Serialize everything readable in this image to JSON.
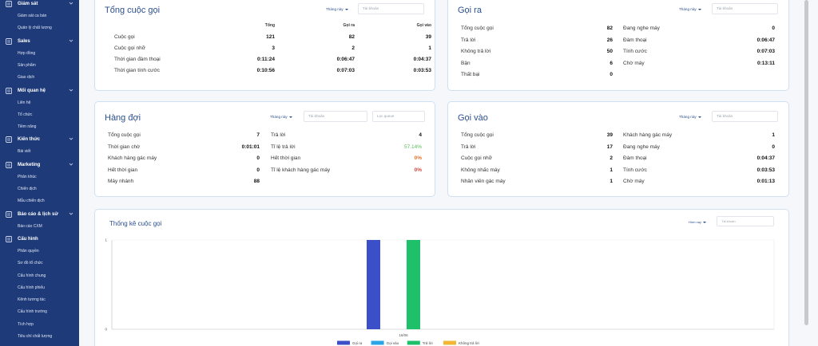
{
  "sidebar": {
    "sections": [
      {
        "label": "Giám sát",
        "items": [
          "Giám sát ca bán",
          "Quản lý chất lượng"
        ]
      },
      {
        "label": "Sales",
        "items": [
          "Hợp đồng",
          "Sản phẩm",
          "Giao dịch"
        ]
      },
      {
        "label": "Mối quan hệ",
        "items": [
          "Liên hệ",
          "Tổ chức",
          "Tiềm năng"
        ]
      },
      {
        "label": "Kiến thức",
        "items": [
          "Bài viết"
        ]
      },
      {
        "label": "Marketing",
        "items": [
          "Phân khúc",
          "Chiến dịch",
          "Mẫu chiến dịch"
        ]
      },
      {
        "label": "Báo cáo & lịch sử",
        "items": [
          "Báo cáo CXM"
        ]
      },
      {
        "label": "Cấu hình",
        "items": [
          "Phân quyền",
          "Sơ đồ tổ chức",
          "Cấu hình chung",
          "Cấu hình phiếu",
          "Kênh tương tác",
          "Cấu hình trường",
          "Tích hợp",
          "Tiêu chí chất lượng"
        ]
      }
    ]
  },
  "total_calls": {
    "title": "Tổng cuộc gọi",
    "period": "Tháng này",
    "account_placeholder": "Tài khoản",
    "headers": [
      "Tổng",
      "Gọi ra",
      "Gọi vào"
    ],
    "rows": [
      {
        "label": "Cuộc gọi",
        "values": [
          "121",
          "82",
          "39"
        ]
      },
      {
        "label": "Cuộc gọi nhỡ",
        "values": [
          "3",
          "2",
          "1"
        ]
      },
      {
        "label": "Thời gian đàm thoại",
        "values": [
          "0:11:24",
          "0:06:47",
          "0:04:37"
        ]
      },
      {
        "label": "Thời gian tính cước",
        "values": [
          "0:10:56",
          "0:07:03",
          "0:03:53"
        ]
      }
    ]
  },
  "outbound": {
    "title": "Gọi ra",
    "period": "Tháng này",
    "account_placeholder": "Tài khoản",
    "left": [
      {
        "label": "Tổng cuộc gọi",
        "value": "82"
      },
      {
        "label": "Trả lời",
        "value": "26"
      },
      {
        "label": "Không trả lời",
        "value": "50"
      },
      {
        "label": "Bận",
        "value": "6"
      },
      {
        "label": "Thất bại",
        "value": "0"
      }
    ],
    "right": [
      {
        "label": "Đang nghe máy",
        "value": "0"
      },
      {
        "label": "Đàm thoại",
        "value": "0:06:47"
      },
      {
        "label": "Tính cước",
        "value": "0:07:03"
      },
      {
        "label": "Chờ máy",
        "value": "0:13:11"
      }
    ]
  },
  "queue": {
    "title": "Hàng đợi",
    "period": "Tháng này",
    "account_placeholder": "Tài khoản",
    "queue_placeholder": "Lọc queue",
    "left": [
      {
        "label": "Tổng cuộc gọi",
        "value": "7"
      },
      {
        "label": "Thời gian chờ",
        "value": "0:01:01"
      },
      {
        "label": "Khách hàng gác máy",
        "value": "0"
      },
      {
        "label": "Hết thời gian",
        "value": "0"
      },
      {
        "label": "Máy nhánh",
        "value": "88"
      }
    ],
    "right": [
      {
        "label": "Trả lời",
        "value": "4"
      },
      {
        "label": "Tỉ lệ trả lời",
        "value": "57.14%"
      },
      {
        "label": "Hết thời gian",
        "value": "0%"
      },
      {
        "label": "Tỉ lệ khách hàng gác máy",
        "value": "0%"
      }
    ],
    "colors": {
      "answer_rate": "#5cb85c",
      "timeout": "#e8712a",
      "hangup": "#d9463a"
    }
  },
  "inbound": {
    "title": "Gọi vào",
    "period": "Tháng này",
    "account_placeholder": "Tài khoản",
    "left": [
      {
        "label": "Tổng cuộc gọi",
        "value": "39"
      },
      {
        "label": "Trả lời",
        "value": "17"
      },
      {
        "label": "Cuộc gọi nhỡ",
        "value": "2"
      },
      {
        "label": "Không nhấc máy",
        "value": "1"
      },
      {
        "label": "Nhân viên gác máy",
        "value": "1"
      }
    ],
    "right": [
      {
        "label": "Khách hàng gác máy",
        "value": "1"
      },
      {
        "label": "Đang nghe máy",
        "value": "0"
      },
      {
        "label": "Đàm thoại",
        "value": "0:04:37"
      },
      {
        "label": "Tính cước",
        "value": "0:03:53"
      },
      {
        "label": "Chờ máy",
        "value": "0:01:13"
      }
    ]
  },
  "stats": {
    "title": "Thống kê cuộc gọi",
    "period": "Hôm nay",
    "account_placeholder": "Tài khoản"
  },
  "chart_data": {
    "type": "bar",
    "categories": [
      "16/06"
    ],
    "ylim": [
      0,
      1
    ],
    "yticks": [
      "0",
      "1"
    ],
    "series": [
      {
        "name": "Gọi ra",
        "values": [
          1
        ],
        "color": "#3a4fc8"
      },
      {
        "name": "Gọi vào",
        "values": [
          0
        ],
        "color": "#2aa6e8"
      },
      {
        "name": "Trả lời",
        "values": [
          1
        ],
        "color": "#1fc06a"
      },
      {
        "name": "Không trả lời",
        "values": [
          0
        ],
        "color": "#f2b632"
      }
    ],
    "grid": false,
    "legend": "bottom"
  }
}
